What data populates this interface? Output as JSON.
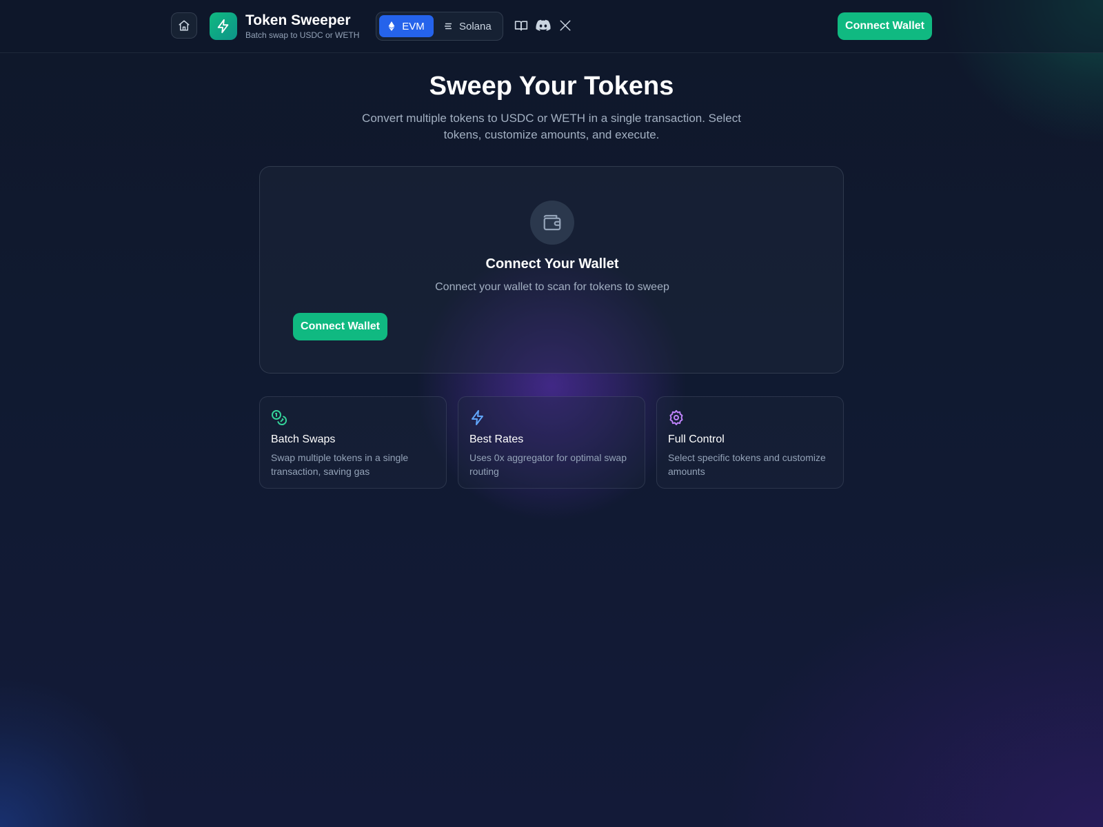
{
  "header": {
    "brand_title": "Token Sweeper",
    "brand_subtitle": "Batch swap to USDC or WETH",
    "chains": [
      {
        "label": "EVM",
        "active": true
      },
      {
        "label": "Solana",
        "active": false
      }
    ],
    "social_icons": [
      "book-icon",
      "discord-icon",
      "x-icon"
    ],
    "connect_label": "Connect Wallet"
  },
  "hero": {
    "title": "Sweep Your Tokens",
    "subtitle": "Convert multiple tokens to USDC or WETH in a single transaction. Select tokens, customize amounts, and execute."
  },
  "connect_card": {
    "icon": "wallet-icon",
    "title": "Connect Your Wallet",
    "subtitle": "Connect your wallet to scan for tokens to sweep",
    "button_label": "Connect Wallet"
  },
  "features": [
    {
      "icon": "coins-icon",
      "title": "Batch Swaps",
      "description": "Swap multiple tokens in a single transaction, saving gas",
      "color": "#34d399"
    },
    {
      "icon": "bolt-icon",
      "title": "Best Rates",
      "description": "Uses 0x aggregator for optimal swap routing",
      "color": "#60a5fa"
    },
    {
      "icon": "gear-icon",
      "title": "Full Control",
      "description": "Select specific tokens and customize amounts",
      "color": "#c084fc"
    }
  ],
  "colors": {
    "accent_green": "#10b981",
    "accent_blue": "#2563eb",
    "background": "#0f172a"
  }
}
